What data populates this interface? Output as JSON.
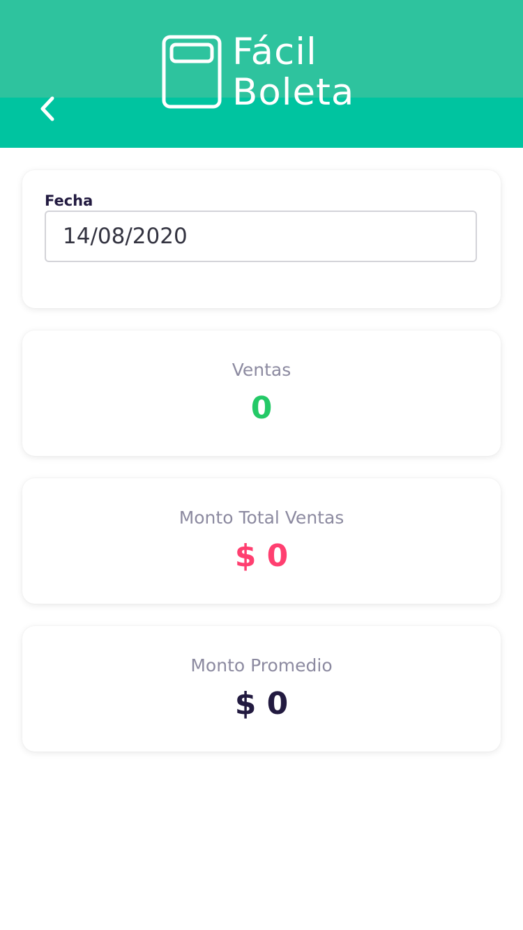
{
  "header": {
    "logo_line1": "Fácil",
    "logo_line2": "Boleta",
    "back_icon": "chevron-left-icon",
    "logo_icon": "wallet-icon",
    "color_top": "#2ec39e",
    "color_bottom": "#00c4a0"
  },
  "date_card": {
    "label": "Fecha",
    "value": "14/08/2020"
  },
  "stats": {
    "ventas": {
      "label": "Ventas",
      "value": "0",
      "color": "#24c967"
    },
    "monto_total": {
      "label": "Monto Total Ventas",
      "value": "$ 0",
      "color": "#ff3f70"
    },
    "monto_promedio": {
      "label": "Monto Promedio",
      "value": "$ 0",
      "color": "#221a40"
    }
  }
}
